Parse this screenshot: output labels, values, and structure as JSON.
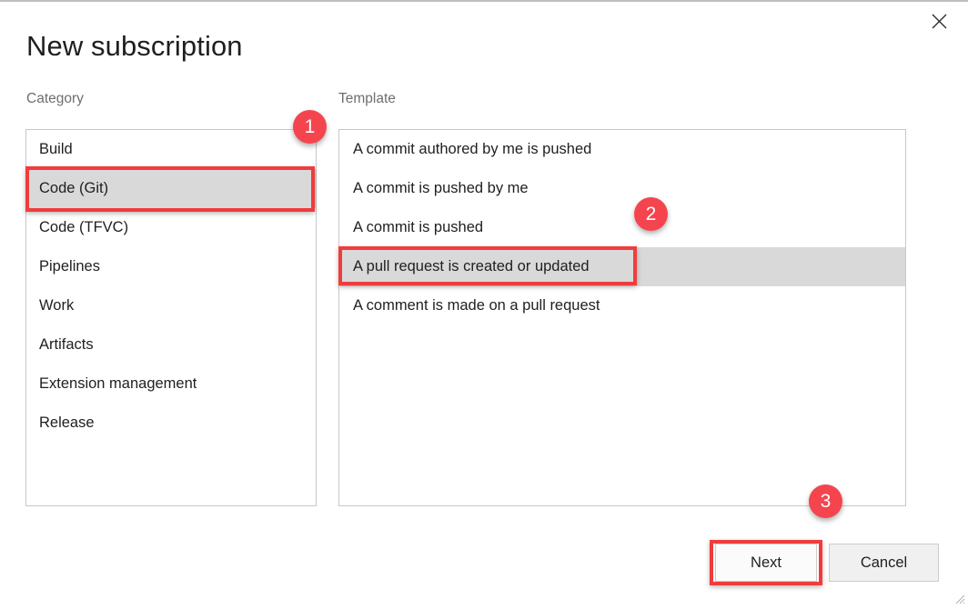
{
  "dialog": {
    "title": "New subscription",
    "close_icon": "close-icon"
  },
  "columns": {
    "category_label": "Category",
    "template_label": "Template"
  },
  "category_list": {
    "items": [
      {
        "label": "Build",
        "selected": false
      },
      {
        "label": "Code (Git)",
        "selected": true
      },
      {
        "label": "Code (TFVC)",
        "selected": false
      },
      {
        "label": "Pipelines",
        "selected": false
      },
      {
        "label": "Work",
        "selected": false
      },
      {
        "label": "Artifacts",
        "selected": false
      },
      {
        "label": "Extension management",
        "selected": false
      },
      {
        "label": "Release",
        "selected": false
      }
    ]
  },
  "template_list": {
    "items": [
      {
        "label": "A commit authored by me is pushed",
        "selected": false
      },
      {
        "label": "A commit is pushed by me",
        "selected": false
      },
      {
        "label": "A commit is pushed",
        "selected": false
      },
      {
        "label": "A pull request is created or updated",
        "selected": true
      },
      {
        "label": "A comment is made on a pull request",
        "selected": false
      }
    ]
  },
  "footer": {
    "next_label": "Next",
    "cancel_label": "Cancel"
  },
  "annotations": {
    "badge_1": "1",
    "badge_2": "2",
    "badge_3": "3",
    "accent_color": "#f4454e",
    "outline_color": "#f03c3c"
  }
}
